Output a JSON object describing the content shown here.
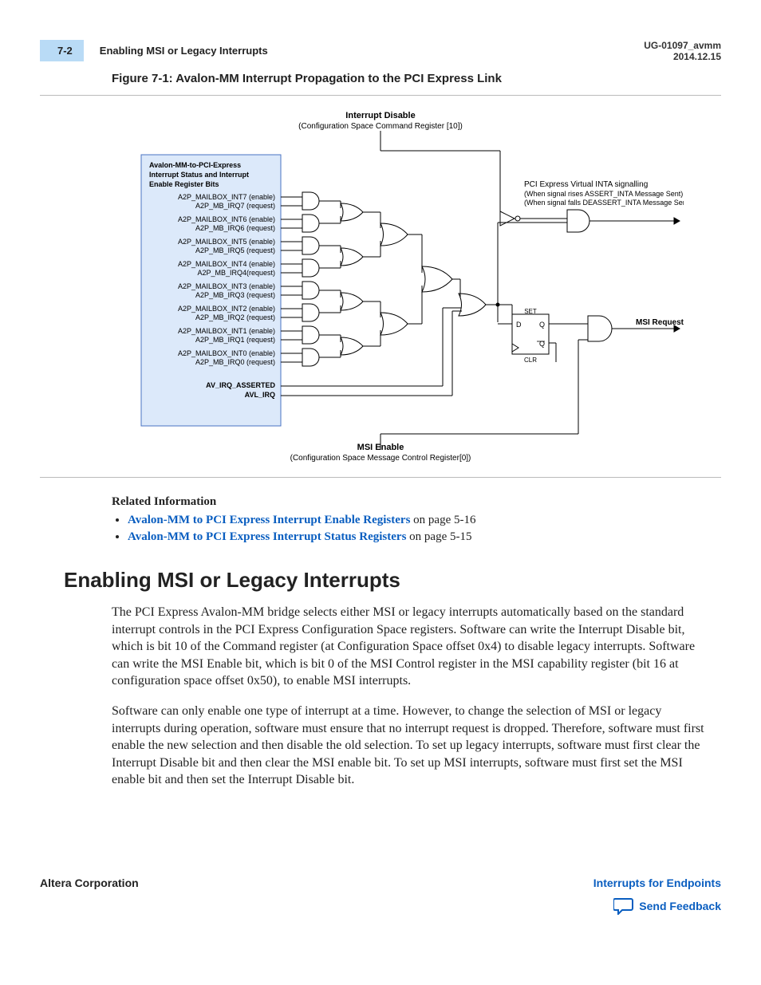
{
  "header": {
    "page_number": "7-2",
    "section_name": "Enabling MSI or Legacy Interrupts",
    "doc_id": "UG-01097_avmm",
    "date": "2014.12.15"
  },
  "figure": {
    "caption": "Figure 7-1: Avalon-MM Interrupt Propagation to the PCI Express Link",
    "top_label_1": "Interrupt Disable",
    "top_label_2": "(Configuration Space Command Register [10])",
    "box_title_1": "Avalon-MM-to-PCI-Express",
    "box_title_2": "Interrupt Status and Interrupt",
    "box_title_3": "Enable Register Bits",
    "signals": [
      {
        "a": "A2P_MAILBOX_INT7 (enable)",
        "b": "A2P_MB_IRQ7 (request)"
      },
      {
        "a": "A2P_MAILBOX_INT6 (enable)",
        "b": "A2P_MB_IRQ6 (request)"
      },
      {
        "a": "A2P_MAILBOX_INT5 (enable)",
        "b": "A2P_MB_IRQ5 (request)"
      },
      {
        "a": "A2P_MAILBOX_INT4 (enable)",
        "b": "A2P_MB_IRQ4(request)"
      },
      {
        "a": "A2P_MAILBOX_INT3 (enable)",
        "b": "A2P_MB_IRQ3 (request)"
      },
      {
        "a": "A2P_MAILBOX_INT2 (enable)",
        "b": "A2P_MB_IRQ2 (request)"
      },
      {
        "a": "A2P_MAILBOX_INT1 (enable)",
        "b": "A2P_MB_IRQ1 (request)"
      },
      {
        "a": "A2P_MAILBOX_INT0 (enable)",
        "b": "A2P_MB_IRQ0 (request)"
      }
    ],
    "av_irq_1": "AV_IRQ_ASSERTED",
    "av_irq_2": "AVL_IRQ",
    "bottom_label_1": "MSI Enable",
    "bottom_label_2": "(Configuration Space Message Control Register[0])",
    "right_label_1": "PCI Express Virtual INTA signalling",
    "right_label_2": "(When signal rises ASSERT_INTA Message Sent)",
    "right_label_3": "(When signal falls DEASSERT_INTA Message Sent)",
    "ff_set": "SET",
    "ff_d": "D",
    "ff_q": "Q",
    "ff_qb": "Q",
    "ff_clr": "CLR",
    "msi_request": "MSI Request"
  },
  "related": {
    "heading": "Related Information",
    "items": [
      {
        "link": "Avalon-MM to PCI Express Interrupt Enable Registers",
        "suffix": " on page 5-16"
      },
      {
        "link": "Avalon-MM to PCI Express Interrupt Status Registers",
        "suffix": " on page 5-15"
      }
    ]
  },
  "section": {
    "title": "Enabling MSI or Legacy Interrupts",
    "para1": "The PCI Express Avalon-MM bridge selects either MSI or legacy interrupts automatically based on the standard interrupt controls in the PCI Express Configuration Space registers. Software can write the Interrupt Disable bit, which is bit 10 of the Command register (at Configuration Space offset 0x4) to disable legacy interrupts. Software can write the MSI Enable bit, which is bit 0 of the MSI Control register in the MSI capability register (bit 16 at configuration space offset 0x50), to enable MSI interrupts.",
    "para2": "Software can only enable one type of interrupt at a time. However, to change the selection of MSI or legacy interrupts during operation, software must ensure that no interrupt request is dropped. Therefore, software must first enable the new selection and then disable the old selection. To set up legacy interrupts, software must first clear the Interrupt Disable bit and then clear the MSI enable bit. To set up MSI interrupts, software must first set the MSI enable bit and then set the Interrupt Disable bit."
  },
  "footer": {
    "corp": "Altera Corporation",
    "right_link": "Interrupts for Endpoints",
    "feedback": "Send Feedback"
  }
}
